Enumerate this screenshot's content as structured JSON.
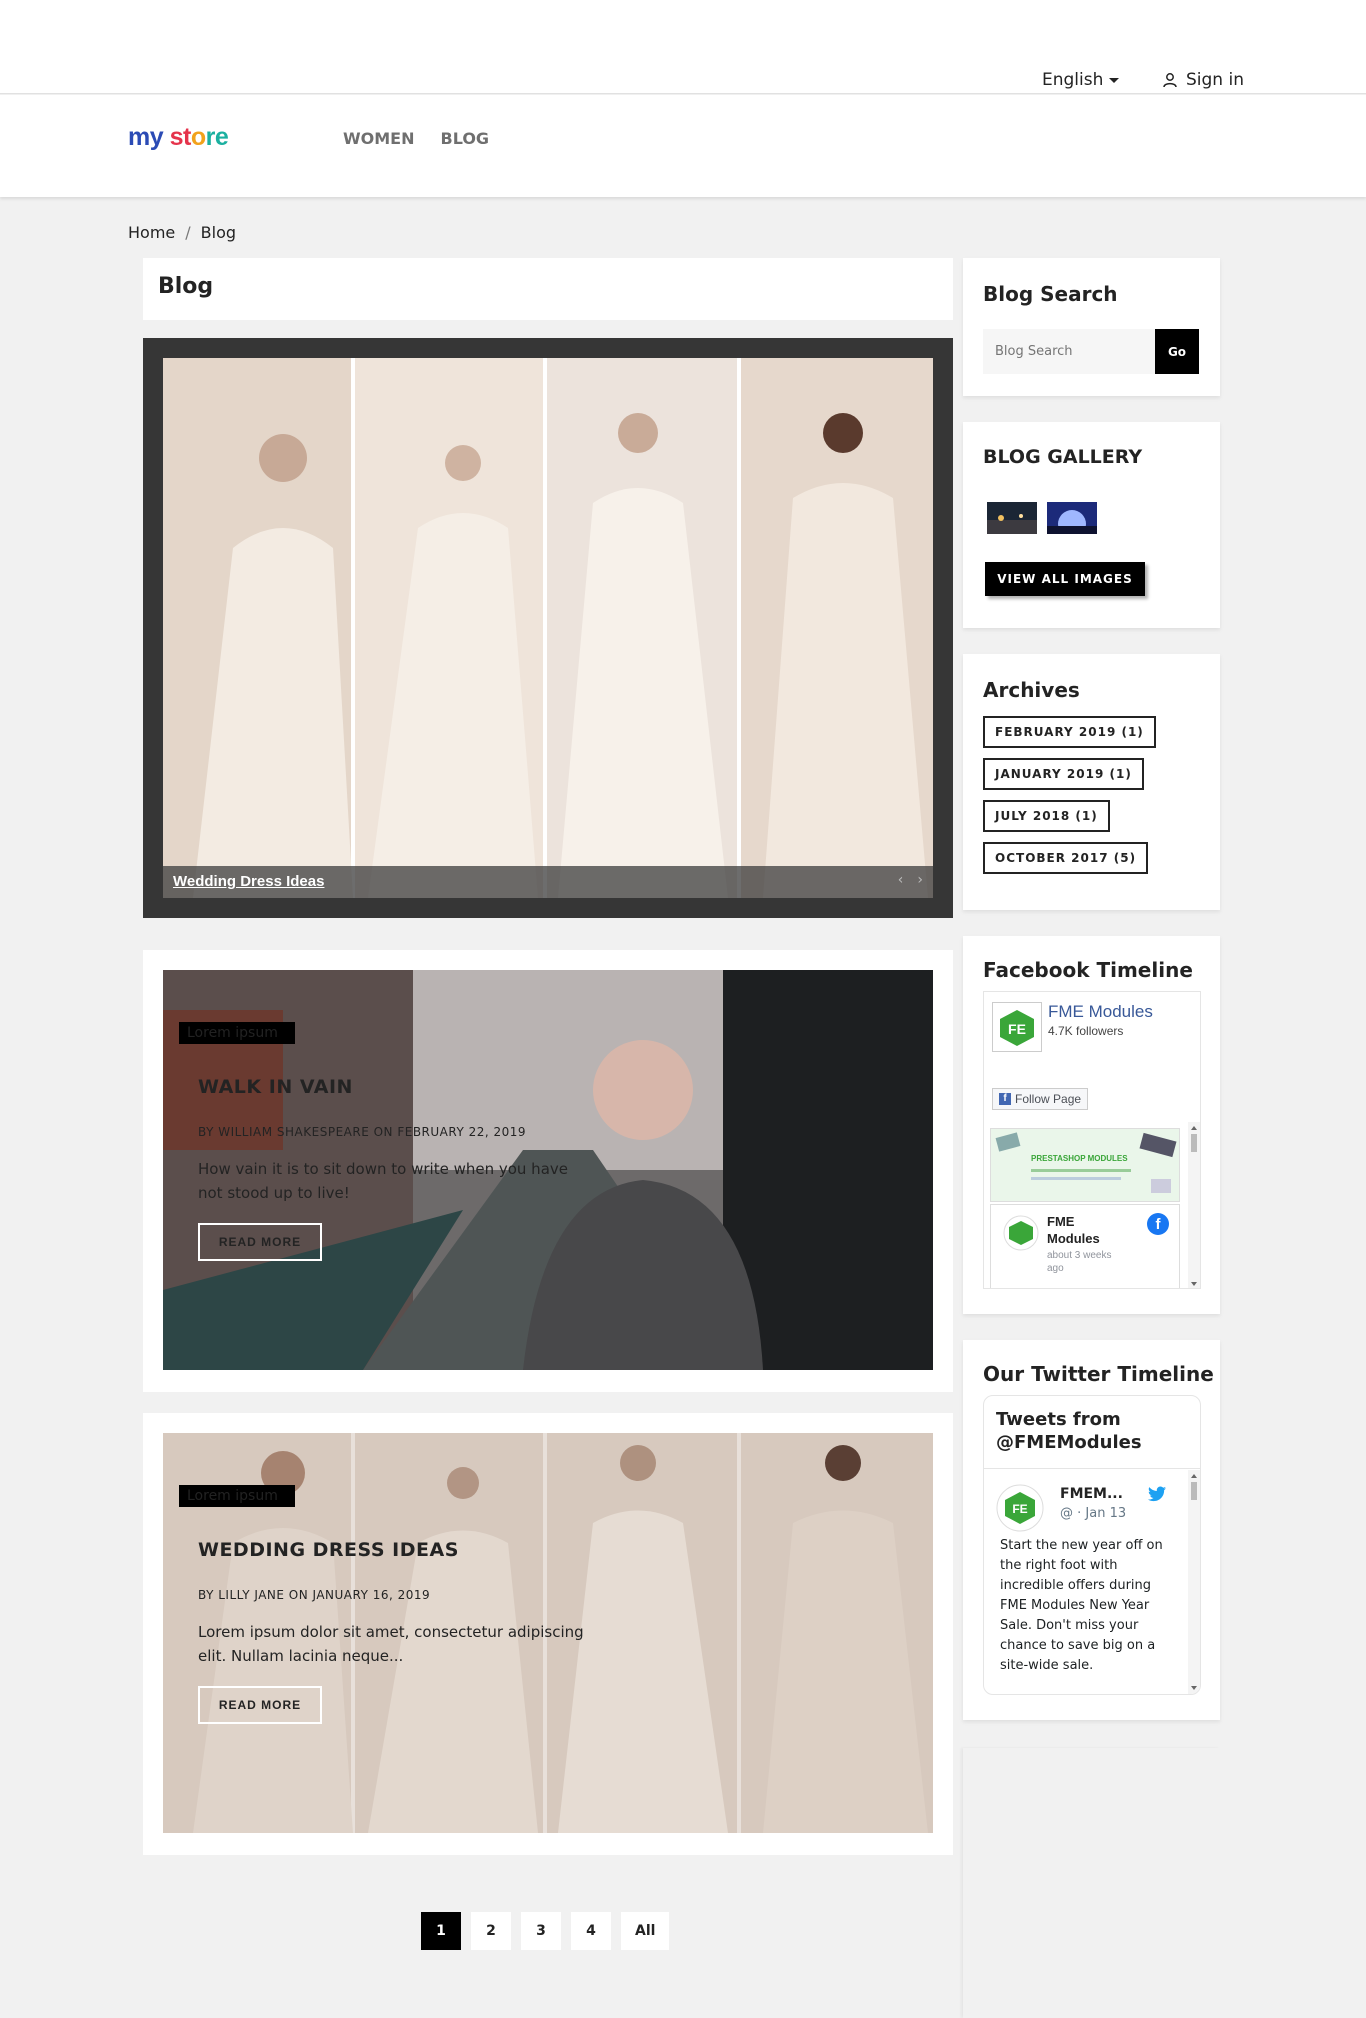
{
  "topbar": {
    "language": "English",
    "sign_in": "Sign in"
  },
  "header": {
    "logo": {
      "part1": "my",
      "part2": "st",
      "part3": "o",
      "part4": "re"
    },
    "nav": [
      "WOMEN",
      "BLOG"
    ]
  },
  "breadcrumb": [
    "Home",
    "Blog"
  ],
  "blog": {
    "title": "Blog",
    "slider": {
      "caption": "Wedding Dress Ideas",
      "prev": "‹",
      "next": "›"
    },
    "posts": [
      {
        "tag": "Lorem ipsum",
        "title": "WALK IN VAIN",
        "meta": "BY WILLIAM SHAKESPEARE  ON FEBRUARY 22, 2019",
        "excerpt": "How vain it is to sit down to write when you have not stood up to live!",
        "read_more": "READ MORE"
      },
      {
        "tag": "Lorem ipsum",
        "title": "WEDDING DRESS IDEAS",
        "meta": "BY LILLY JANE  ON JANUARY 16, 2019",
        "excerpt": "Lorem ipsum dolor sit amet, consectetur adipiscing elit. Nullam lacinia neque...",
        "read_more": "READ MORE"
      }
    ],
    "pagination": [
      "1",
      "2",
      "3",
      "4",
      "All"
    ]
  },
  "sidebar": {
    "search": {
      "title": "Blog Search",
      "placeholder": "Blog Search",
      "button": "Go"
    },
    "gallery": {
      "title": "BLOG GALLERY",
      "view_all": "VIEW ALL IMAGES"
    },
    "archives": {
      "title": "Archives",
      "items": [
        "FEBRUARY 2019 (1)",
        "JANUARY 2019 (1)",
        "JULY 2018 (1)",
        "OCTOBER 2017 (5)"
      ]
    },
    "facebook": {
      "title": "Facebook Timeline",
      "page_name": "FME Modules",
      "followers": "4.7K followers",
      "follow": "Follow Page",
      "banner": "PRESTASHOP MODULES",
      "post_author": "FME Modules",
      "post_time": "about 3 weeks ago"
    },
    "twitter": {
      "title": "Our Twitter Timeline",
      "header": "Tweets from @FMEModules",
      "author": "FMEM...",
      "handle": "@ · Jan 13",
      "text": "Start the new year off on the right foot with incredible offers during FME Modules New Year Sale. Don't miss your chance to save big on a site-wide sale."
    }
  },
  "colors": {
    "accent": "#000000",
    "fb_blue": "#1877f2",
    "twitter_blue": "#1da1f2",
    "fme_green": "#3aa639"
  }
}
